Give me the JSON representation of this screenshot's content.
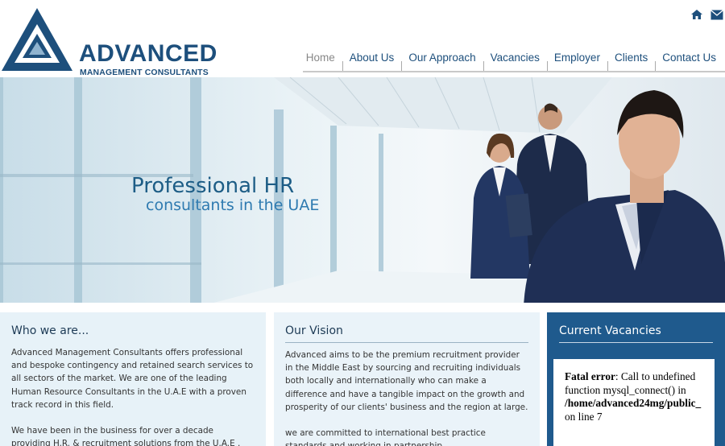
{
  "header": {
    "logo_text": "ADVANCED",
    "logo_subtext": "MANAGEMENT CONSULTANTS",
    "icons": [
      "home-icon",
      "mail-icon"
    ]
  },
  "nav": {
    "items": [
      {
        "label": "Home",
        "active": true
      },
      {
        "label": "About Us",
        "active": false
      },
      {
        "label": "Our Approach",
        "active": false
      },
      {
        "label": "Vacancies",
        "active": false
      },
      {
        "label": "Employer",
        "active": false
      },
      {
        "label": "Clients",
        "active": false
      },
      {
        "label": "Contact Us",
        "active": false
      }
    ]
  },
  "hero": {
    "title": "Professional HR",
    "subtitle": "consultants in the UAE"
  },
  "who_we_are": {
    "heading": "Who we are...",
    "para1": "Advanced Management Consultants offers professional and bespoke contingency and retained search services to all sectors of the market. We are one of the leading Human Resource Consultants in the U.A.E with a proven track record in this field.",
    "para2": "We have been in the business for over a decade providing H.R. & recruitment solutions from the U.A.E ."
  },
  "vision": {
    "heading": "Our Vision",
    "para1": "Advanced aims to be the premium recruitment provider in the Middle East by sourcing and recruiting individuals both locally and internationally who can make a difference and have a tangible impact on the growth and prosperity of our clients' business and the region at large.",
    "para2": "we are committed to international best practice standards and working in partnership"
  },
  "vacancies": {
    "heading": "Current Vacancies",
    "error_label": "Fatal error",
    "error_text": ": Call to undefined function mysql_connect() in",
    "error_path": "/home/advanced24mg/public_",
    "error_line": " on line 7"
  },
  "colors": {
    "brand_blue": "#1d4f7c",
    "panel_dark": "#1f5a8d",
    "panel_light": "#e7f2f8"
  }
}
